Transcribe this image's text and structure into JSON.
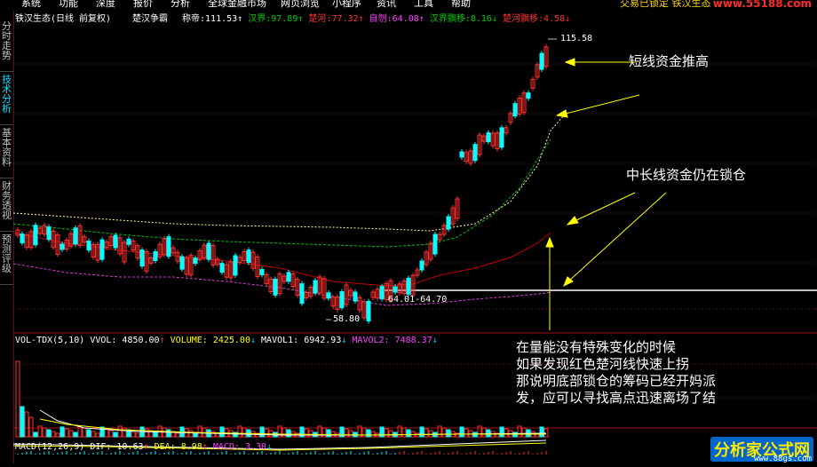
{
  "menu": {
    "items": [
      "系统",
      "功能",
      "深度",
      "报价",
      "分析",
      "全球金融市场",
      "网页浏览",
      "小程序",
      "资讯",
      "工具",
      "帮助"
    ],
    "security": "交易已锁定 铁汉生态",
    "site": "www.55188.com"
  },
  "side_tabs": [
    "分时走势",
    "技术分析",
    "基本资料",
    "财务透视",
    "预测评级"
  ],
  "header": {
    "stock": "铁汉生态(日线 前复权)",
    "indicator": "楚汉争霸",
    "items": [
      {
        "label": "称帝:",
        "value": "111.53",
        "arrow": "↑",
        "color": "#ffffff"
      },
      {
        "label": "汉界:",
        "value": "97.89",
        "arrow": "↑",
        "color": "#00d000"
      },
      {
        "label": "楚河:",
        "value": "77.32",
        "arrow": "↑",
        "color": "#ff3030"
      },
      {
        "label": "自刎:",
        "value": "64.08",
        "arrow": "↑",
        "color": "#ff40ff"
      },
      {
        "label": "汉界飘移:",
        "value": "8.16",
        "arrow": "↓",
        "color": "#00d000"
      },
      {
        "label": "楚河飘移:",
        "value": "4.58",
        "arrow": "↓",
        "color": "#ff3030"
      }
    ]
  },
  "price_labels": {
    "high": "115.58",
    "low": "58.80",
    "range": "64.01-64.70"
  },
  "annotations": {
    "short_term": "短线资金推高",
    "long_term": "中长线资金仍在锁仓",
    "explanation": [
      "在量能没有特殊变化的时候",
      "如果发现红色楚河线快速上拐",
      "那说明底部锁仓的筹码已经开妈派",
      "发，应可以寻找高点迅速离场了结"
    ]
  },
  "volume_header": {
    "name": "VOL-TDX(5,10)",
    "vvol": "VVOL: 4850.00",
    "vvol_arrow": "↑",
    "volume": "VOLUME: 2425.00",
    "volume_arrow": "↓",
    "mavol1": "MAVOL1: 6942.93",
    "mavol1_arrow": "↓",
    "mavol2": "MAVOL2: 7488.37",
    "mavol2_arrow": "↓"
  },
  "macd_header": {
    "name": "MACD(12,26,9)",
    "dif": "DIF: 10.63",
    "dif_arrow": "↑",
    "dea": "DEA: 8.98",
    "dea_arrow": "↑",
    "macd": "MACD: 3.30",
    "macd_arrow": "↓"
  },
  "watermark": "分析家公式网",
  "watermark_url": "www.88gs.com",
  "colors": {
    "up": "#ff3030",
    "down": "#00ffff",
    "white_line": "#ffffaa",
    "green_line": "#00c000",
    "red_line": "#c00000",
    "purple_line": "#d040d0",
    "annotation_arrow": "#ffff00"
  }
}
